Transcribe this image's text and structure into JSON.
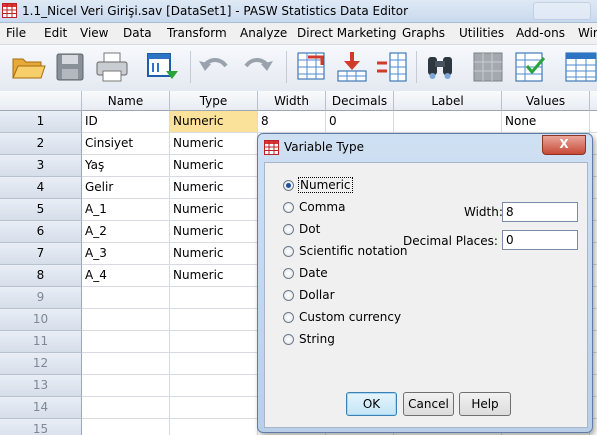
{
  "window": {
    "title": "1.1_Nicel Veri Girişi.sav [DataSet1] - PASW Statistics Data Editor"
  },
  "menu": [
    "File",
    "Edit",
    "View",
    "Data",
    "Transform",
    "Analyze",
    "Direct Marketing",
    "Graphs",
    "Utilities",
    "Add-ons",
    "Win"
  ],
  "toolbar": [
    "open-icon",
    "save-icon",
    "print-icon",
    "dialog-recall-icon",
    "undo-icon",
    "redo-icon",
    "goto-case-icon",
    "insert-cases-icon",
    "variables-icon",
    "find-icon",
    "split-file-icon",
    "select-cases-icon",
    "value-labels-icon"
  ],
  "grid": {
    "columns": [
      "Name",
      "Type",
      "Width",
      "Decimals",
      "Label",
      "Values"
    ],
    "rows": [
      {
        "num": "1",
        "name": "ID",
        "type": "Numeric",
        "width": "8",
        "decimals": "0",
        "label": "",
        "values": "None"
      },
      {
        "num": "2",
        "name": "Cinsiyet",
        "type": "Numeric"
      },
      {
        "num": "3",
        "name": "Yaş",
        "type": "Numeric"
      },
      {
        "num": "4",
        "name": "Gelir",
        "type": "Numeric"
      },
      {
        "num": "5",
        "name": "A_1",
        "type": "Numeric"
      },
      {
        "num": "6",
        "name": "A_2",
        "type": "Numeric"
      },
      {
        "num": "7",
        "name": "A_3",
        "type": "Numeric"
      },
      {
        "num": "8",
        "name": "A_4",
        "type": "Numeric"
      },
      {
        "num": "9"
      },
      {
        "num": "10"
      },
      {
        "num": "11"
      },
      {
        "num": "12"
      },
      {
        "num": "13"
      },
      {
        "num": "14"
      },
      {
        "num": "15"
      }
    ]
  },
  "dialog": {
    "title": "Variable Type",
    "close": "X",
    "options": [
      "Numeric",
      "Comma",
      "Dot",
      "Scientific notation",
      "Date",
      "Dollar",
      "Custom currency",
      "String"
    ],
    "selected": "Numeric",
    "width_label": "Width:",
    "width_value": "8",
    "decimals_label": "Decimal Places:",
    "decimals_value": "0",
    "ok": "OK",
    "cancel": "Cancel",
    "help": "Help"
  }
}
